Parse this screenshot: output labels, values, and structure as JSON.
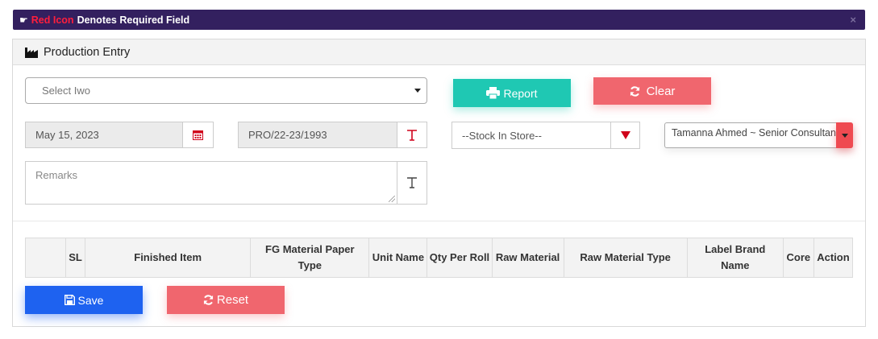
{
  "alert": {
    "red_text": "Red Icon",
    "rest_text": "Denotes Required Field",
    "close_glyph": "×"
  },
  "panel": {
    "title": "Production Entry",
    "title_icon": "factory-icon"
  },
  "form": {
    "iwo_placeholder": "Select Iwo",
    "report_label": "Report",
    "clear_label": "Clear",
    "date_value": "May 15, 2023",
    "pro_number": "PRO/22-23/1993",
    "stock_value": "--Stock In Store--",
    "employee_value": "Tamanna Ahmed ~ Senior Consultant",
    "remarks_placeholder": "Remarks"
  },
  "table": {
    "headers": [
      "",
      "SL",
      "Finished Item",
      "FG Material Paper Type",
      "Unit Name",
      "Qty Per Roll",
      "Raw Material",
      "Raw Material Type",
      "Label Brand Name",
      "Core",
      "Action"
    ]
  },
  "actions": {
    "save_label": "Save",
    "reset_label": "Reset"
  },
  "colors": {
    "alert_bg": "#33205f",
    "required_red": "#ff1e3c",
    "report_teal": "#1fc8b3",
    "clear_red": "#f0666e",
    "save_blue": "#1e62f0"
  }
}
